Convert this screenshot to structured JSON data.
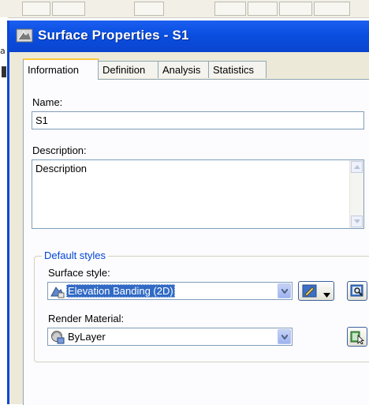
{
  "background": {
    "left_fragment": "a"
  },
  "dialog": {
    "title": "Surface Properties - S1"
  },
  "tabs": [
    {
      "label": "Information",
      "active": true
    },
    {
      "label": "Definition",
      "active": false
    },
    {
      "label": "Analysis",
      "active": false
    },
    {
      "label": "Statistics",
      "active": false
    }
  ],
  "information": {
    "name_label": "Name:",
    "name_value": "S1",
    "description_label": "Description:",
    "description_value": "Description",
    "default_styles": {
      "group_title": "Default styles",
      "surface_style_label": "Surface style:",
      "surface_style_value": "Elevation Banding (2D)",
      "render_material_label": "Render Material:",
      "render_material_value": "ByLayer"
    }
  },
  "colors": {
    "titlebar": "#0a4fe0",
    "dialog_face": "#ece9d8",
    "group_title": "#0046d5",
    "selection": "#316ac5",
    "active_tab_accent": "#ffc83c"
  },
  "icons": {
    "title": "civil3d-app-icon",
    "surface_style": "surface-style-icon",
    "render_material": "render-material-icon",
    "edit_style": "edit-style-icon",
    "preview_style": "preview-style-icon",
    "pick_material": "pick-material-icon"
  }
}
